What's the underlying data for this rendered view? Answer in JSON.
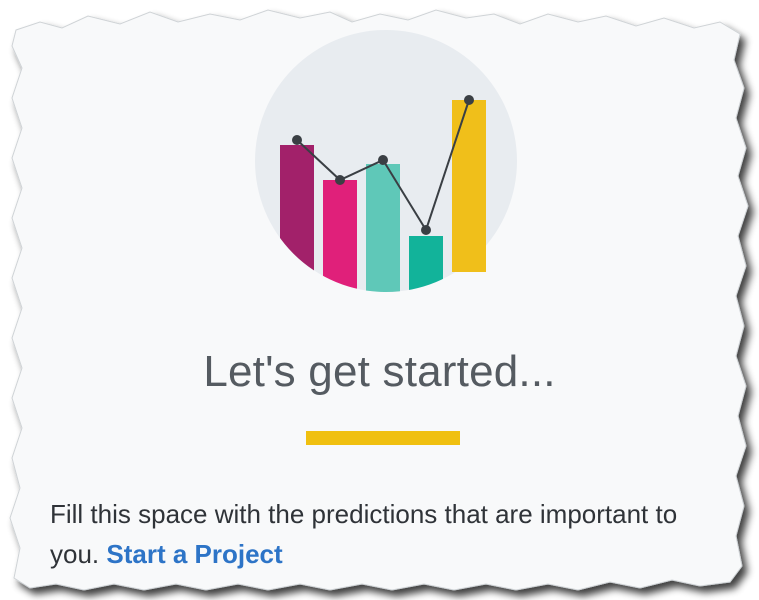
{
  "empty_state": {
    "headline": "Let's get started...",
    "message": "Fill this space with the predictions that are important to you.",
    "link_label": "Start a Project"
  },
  "illustration": {
    "bars": [
      {
        "name": "bar-1",
        "color": "#a2216a"
      },
      {
        "name": "bar-2",
        "color": "#e0207a"
      },
      {
        "name": "bar-3",
        "color": "#5fc8b8"
      },
      {
        "name": "bar-4",
        "color": "#12b39a"
      },
      {
        "name": "bar-5",
        "color": "#f0bf1a"
      }
    ],
    "circle_color": "#e8ecf0",
    "line_color": "#3a3f44"
  },
  "colors": {
    "accent": "#f0c010",
    "link": "#2d74c7",
    "text": "#2f3338",
    "headline": "#555b61"
  }
}
